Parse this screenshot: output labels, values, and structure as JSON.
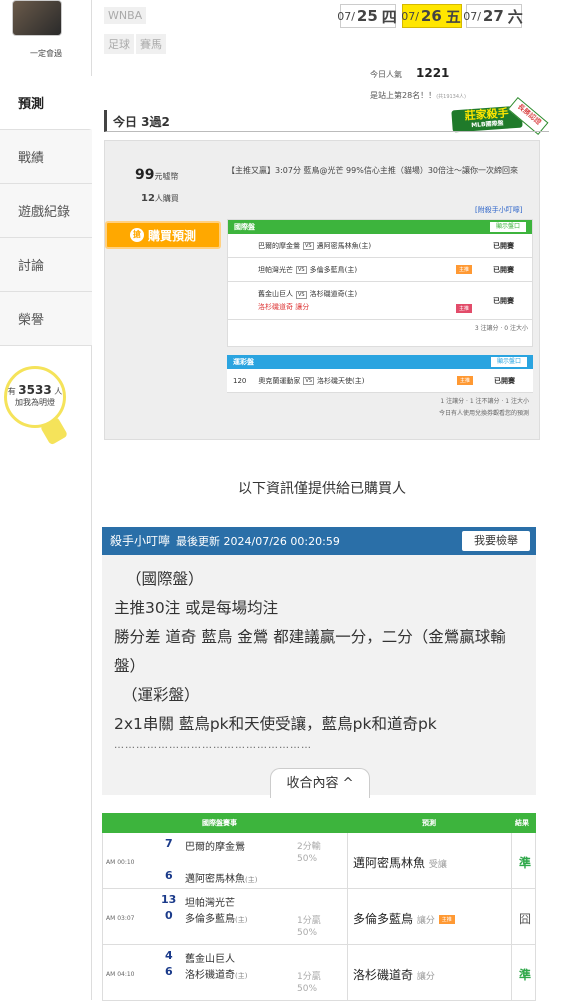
{
  "sidebar": {
    "username": "一定會過",
    "items": [
      {
        "label": "預測"
      },
      {
        "label": "戰績"
      },
      {
        "label": "遊戲紀錄"
      },
      {
        "label": "討論"
      },
      {
        "label": "榮譽"
      }
    ],
    "fans_prefix": "有",
    "fans_count": "3533",
    "fans_suffix": "人",
    "fans_note": "加我為明燈"
  },
  "tags": [
    "WNBA",
    "足球",
    "賽馬"
  ],
  "dates": [
    {
      "date": "07/",
      "day": "25",
      "wk": "四"
    },
    {
      "date": "07/",
      "day": "26",
      "wk": "五"
    },
    {
      "date": "07/",
      "day": "27",
      "wk": "六"
    }
  ],
  "stats": {
    "popularity_label": "今日人氣",
    "popularity_value": "1221",
    "rank_text": "是站上第28名！！",
    "rank_small": "(共19134人)"
  },
  "logo": {
    "title": "莊家殺手",
    "sub": "MLB國際盤",
    "ribbon": "長勝認證"
  },
  "today": {
    "title": "今日 3過2"
  },
  "pick": {
    "price_value": "99",
    "price_unit": "元噓幣",
    "buyers_value": "12",
    "buyers_unit": "人購買",
    "buy_button": "購買預測",
    "buy_icon": "搶",
    "headline": "【主推又贏】3:07分 藍鳥@光芒 99%信心主推（貓場）30倍注～讓你一次締回來",
    "attach_link": "[附殺手小叮嚀]"
  },
  "intl": {
    "title": "國際盤",
    "show": "顯示盤口",
    "rows": [
      {
        "away": "巴爾的摩金鶯",
        "home": "邁阿密馬林魚(主)",
        "badge": "",
        "status": "已開賽"
      },
      {
        "away": "坦帕灣光芒",
        "home": "多倫多藍鳥(主)",
        "badge": "主推",
        "status": "已開賽"
      },
      {
        "away": "舊金山巨人",
        "home": "洛杉磯道奇(主)",
        "pick": "洛杉磯道奇",
        "pick_type": "讓分",
        "badge": "主推",
        "status": "已開賽"
      }
    ],
    "note": "3 注讓分 · 0 注大小"
  },
  "lottery": {
    "title": "運彩盤",
    "show": "顯示盤口",
    "rows": [
      {
        "no": "120",
        "away": "奧克蘭運動家",
        "home": "洛杉磯天使(主)",
        "badge": "主推",
        "status": "已開賽"
      }
    ],
    "note1": "1 注讓分 · 1 注不讓分 · 1 注大小",
    "note2": "今日有人使用兌換券觀看您的預測"
  },
  "info_title": "以下資訊僅提供給已購買人",
  "killer": {
    "title": "殺手小叮嚀",
    "updated": "最後更新 2024/07/26 00:20:59",
    "report_button": "我要檢舉",
    "lines": [
      "（國際盤）",
      "主推30注 或是每場均注",
      "勝分差 道奇 藍鳥 金鶯 都建議贏一分，二分（金鶯贏球輸盤）",
      "（運彩盤）",
      "2x1串關 藍鳥pk和天使受讓，藍鳥pk和道奇pk"
    ],
    "dots": "………………………………………………",
    "collapse": "收合內容 ^"
  },
  "results": {
    "headers": [
      "國際盤賽事",
      "預測",
      "結果"
    ],
    "rows": [
      {
        "time": "AM 00:10",
        "away_num": "7",
        "away": "巴爾的摩金鶯",
        "home_num": "6",
        "home": "邁阿密馬林魚",
        "home_tag": "(主)",
        "handicap": "2分輸",
        "pct": "50%",
        "pred": "邁阿密馬林魚",
        "pred_type": "受讓",
        "result": "準"
      },
      {
        "time": "AM 03:07",
        "away_num": "13",
        "away": "坦帕灣光芒",
        "home_num": "0",
        "home": "多倫多藍鳥",
        "home_tag": "(主)",
        "handicap": "1分贏",
        "pct": "50%",
        "pred": "多倫多藍鳥",
        "pred_type": "讓分",
        "pred_badge": "主推",
        "result": "囧"
      },
      {
        "time": "AM 04:10",
        "away_num": "4",
        "away": "舊金山巨人",
        "home_num": "6",
        "home": "洛杉磯道奇",
        "home_tag": "(主)",
        "handicap": "1分贏",
        "pct": "50%",
        "pred": "洛杉磯道奇",
        "pred_type": "讓分",
        "result": "準"
      }
    ]
  }
}
